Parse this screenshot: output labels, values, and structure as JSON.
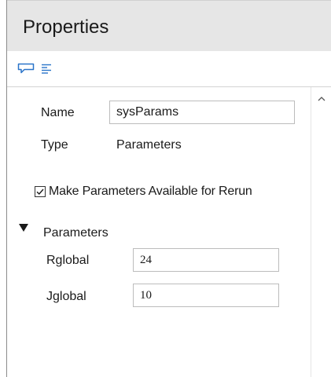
{
  "panel": {
    "title": "Properties"
  },
  "toolbar": {
    "items": [
      {
        "icon": "comment-icon"
      },
      {
        "icon": "align-left-icon"
      }
    ]
  },
  "properties": {
    "name_label": "Name",
    "name_value": "sysParams",
    "type_label": "Type",
    "type_value": "Parameters",
    "rerun_checkbox_label": "Make Parameters Available for Rerun",
    "rerun_checked": true
  },
  "parameters_section": {
    "label": "Parameters",
    "expanded": true,
    "fields": [
      {
        "label": "Rglobal",
        "value": "24"
      },
      {
        "label": "Jglobal",
        "value": "10"
      }
    ]
  },
  "colors": {
    "header_bg": "#e6e6e6",
    "icon_blue": "#2a74c9",
    "border": "#bcbcbc"
  }
}
